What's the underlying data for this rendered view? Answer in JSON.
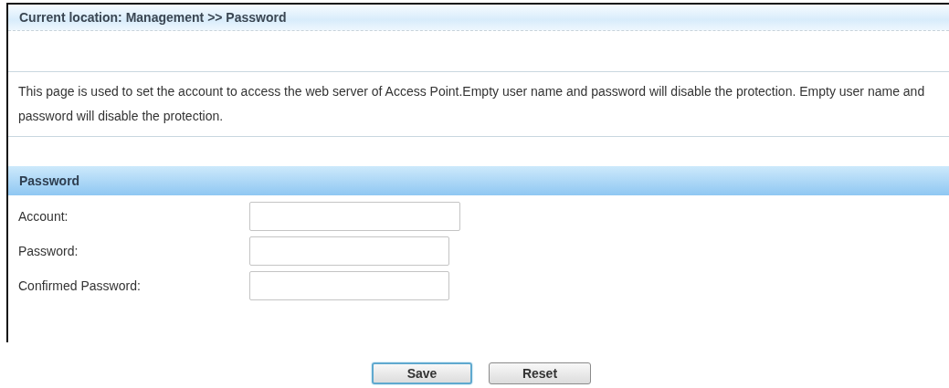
{
  "breadcrumb": "Current location: Management >> Password",
  "description": "This page is used to set the account to access the web server of Access Point.Empty user name and password will disable the protection. Empty user name and password will disable the protection.",
  "section_title": "Password",
  "fields": [
    {
      "label": "Account:",
      "wide": true
    },
    {
      "label": "Password:",
      "wide": false
    },
    {
      "label": "Confirmed Password:",
      "wide": false
    }
  ],
  "buttons": [
    {
      "label": "Save",
      "focused": true
    },
    {
      "label": "Reset",
      "focused": false
    }
  ]
}
